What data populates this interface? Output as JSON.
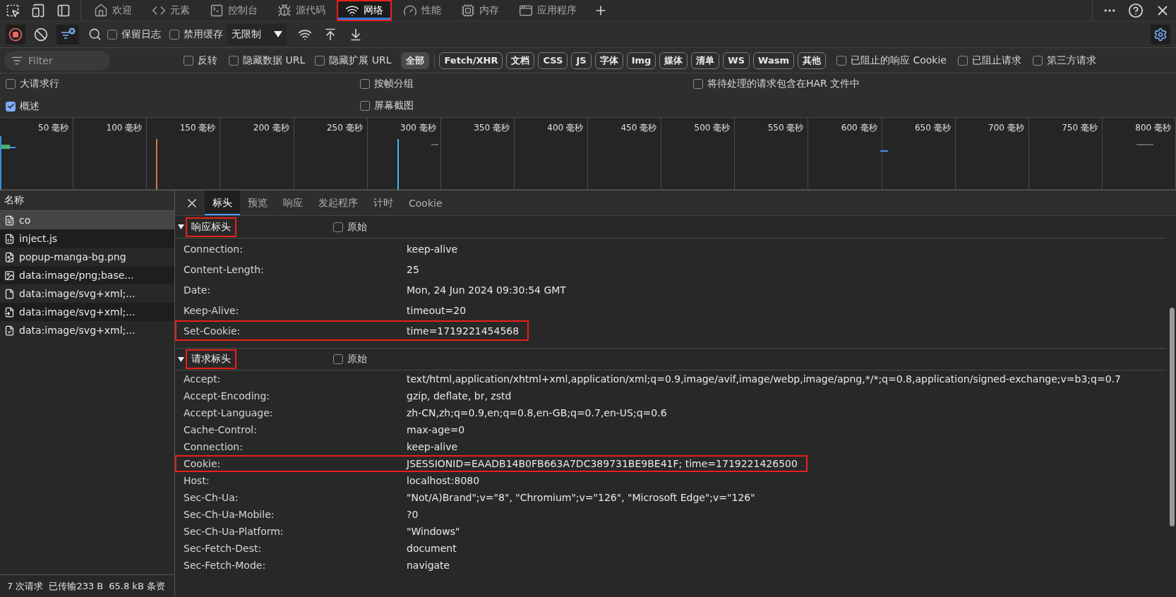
{
  "top_tabs": [
    {
      "label": "欢迎",
      "selected": false,
      "highlighted": false
    },
    {
      "label": "元素",
      "selected": false,
      "highlighted": false
    },
    {
      "label": "控制台",
      "selected": false,
      "highlighted": false
    },
    {
      "label": "源代码",
      "selected": false,
      "highlighted": false
    },
    {
      "label": "网络",
      "selected": true,
      "highlighted": true
    },
    {
      "label": "性能",
      "selected": false,
      "highlighted": false
    },
    {
      "label": "内存",
      "selected": false,
      "highlighted": false
    },
    {
      "label": "应用程序",
      "selected": false,
      "highlighted": false
    }
  ],
  "toolbar": {
    "recording": true,
    "filter_active": true,
    "preserve_log": {
      "label": "保留日志",
      "checked": false
    },
    "disable_cache": {
      "label": "禁用缓存",
      "checked": false
    },
    "throttling": "无限制"
  },
  "filter_bar": {
    "placeholder": "Filter",
    "options": [
      {
        "label": "反转",
        "checked": false
      },
      {
        "label": "隐藏数据 URL",
        "checked": false
      },
      {
        "label": "隐藏扩展 URL",
        "checked": false
      }
    ],
    "types": [
      {
        "label": "全部",
        "selected": true
      },
      {
        "label": "Fetch/XHR",
        "selected": false
      },
      {
        "label": "文档",
        "selected": false
      },
      {
        "label": "CSS",
        "selected": false
      },
      {
        "label": "JS",
        "selected": false
      },
      {
        "label": "字体",
        "selected": false
      },
      {
        "label": "Img",
        "selected": false
      },
      {
        "label": "媒体",
        "selected": false
      },
      {
        "label": "清单",
        "selected": false
      },
      {
        "label": "WS",
        "selected": false
      },
      {
        "label": "Wasm",
        "selected": false
      },
      {
        "label": "其他",
        "selected": false
      }
    ],
    "extra_options": [
      {
        "label": "已阻止的响应 Cookie",
        "checked": false
      },
      {
        "label": "已阻止请求",
        "checked": false
      },
      {
        "label": "第三方请求",
        "checked": false
      }
    ]
  },
  "settings": [
    {
      "label": "大请求行",
      "checked": false
    },
    {
      "label": "按帧分组",
      "checked": false
    },
    {
      "label": "将待处理的请求包含在HAR 文件中",
      "checked": false
    },
    {
      "label": "概述",
      "checked": true
    },
    {
      "label": "屏幕截图",
      "checked": false
    }
  ],
  "timeline": {
    "ticks": [
      "50 毫秒",
      "100 毫秒",
      "150 毫秒",
      "200 毫秒",
      "250 毫秒",
      "300 毫秒",
      "350 毫秒",
      "400 毫秒",
      "450 毫秒",
      "500 毫秒",
      "550 毫秒",
      "600 毫秒",
      "650 毫秒",
      "700 毫秒",
      "750 毫秒",
      "800 毫秒"
    ]
  },
  "requests": {
    "column": "名称",
    "rows": [
      {
        "name": "co",
        "kind": "document",
        "selected": true
      },
      {
        "name": "inject.js",
        "kind": "script",
        "selected": false
      },
      {
        "name": "popup-manga-bg.png",
        "kind": "image",
        "selected": false
      },
      {
        "name": "data:image/png;base...",
        "kind": "data-image",
        "selected": false
      },
      {
        "name": "data:image/svg+xml;...",
        "kind": "svg",
        "selected": false
      },
      {
        "name": "data:image/svg+xml;...",
        "kind": "svg-arrow",
        "selected": false
      },
      {
        "name": "data:image/svg+xml;...",
        "kind": "svg-check",
        "selected": false
      }
    ]
  },
  "status_bar": [
    "7 次请求",
    "已传输233 B",
    "65.8 kB 条资"
  ],
  "details": {
    "tabs": [
      {
        "label": "标头",
        "selected": true
      },
      {
        "label": "预览",
        "selected": false
      },
      {
        "label": "响应",
        "selected": false
      },
      {
        "label": "发起程序",
        "selected": false
      },
      {
        "label": "计时",
        "selected": false
      },
      {
        "label": "Cookie",
        "selected": false
      }
    ],
    "sections": [
      {
        "title": "响应标头",
        "highlighted": true,
        "expanded": true,
        "kind": "response",
        "raw": {
          "label": "原始",
          "checked": false
        },
        "rows": [
          {
            "name": "Connection:",
            "value": "keep-alive",
            "highlighted": false
          },
          {
            "name": "Content-Length:",
            "value": "25",
            "highlighted": false
          },
          {
            "name": "Date:",
            "value": "Mon, 24 Jun 2024 09:30:54 GMT",
            "highlighted": false
          },
          {
            "name": "Keep-Alive:",
            "value": "timeout=20",
            "highlighted": false
          },
          {
            "name": "Set-Cookie:",
            "value": "time=1719221454568",
            "highlighted": true
          }
        ]
      },
      {
        "title": "请求标头",
        "highlighted": true,
        "expanded": true,
        "kind": "request",
        "raw": {
          "label": "原始",
          "checked": false
        },
        "rows": [
          {
            "name": "Accept:",
            "value": "text/html,application/xhtml+xml,application/xml;q=0.9,image/avif,image/webp,image/apng,*/*;q=0.8,application/signed-exchange;v=b3;q=0.7",
            "highlighted": false
          },
          {
            "name": "Accept-Encoding:",
            "value": "gzip, deflate, br, zstd",
            "highlighted": false
          },
          {
            "name": "Accept-Language:",
            "value": "zh-CN,zh;q=0.9,en;q=0.8,en-GB;q=0.7,en-US;q=0.6",
            "highlighted": false
          },
          {
            "name": "Cache-Control:",
            "value": "max-age=0",
            "highlighted": false
          },
          {
            "name": "Connection:",
            "value": "keep-alive",
            "highlighted": false
          },
          {
            "name": "Cookie:",
            "value": "JSESSIONID=EAADB14B0FB663A7DC389731BE9BE41F; time=1719221426500",
            "highlighted": true
          },
          {
            "name": "Host:",
            "value": "localhost:8080",
            "highlighted": false
          },
          {
            "name": "Sec-Ch-Ua:",
            "value": "\"Not/A)Brand\";v=\"8\", \"Chromium\";v=\"126\", \"Microsoft Edge\";v=\"126\"",
            "highlighted": false
          },
          {
            "name": "Sec-Ch-Ua-Mobile:",
            "value": "?0",
            "highlighted": false
          },
          {
            "name": "Sec-Ch-Ua-Platform:",
            "value": "\"Windows\"",
            "highlighted": false
          },
          {
            "name": "Sec-Fetch-Dest:",
            "value": "document",
            "highlighted": false
          },
          {
            "name": "Sec-Fetch-Mode:",
            "value": "navigate",
            "highlighted": false
          }
        ]
      }
    ]
  }
}
